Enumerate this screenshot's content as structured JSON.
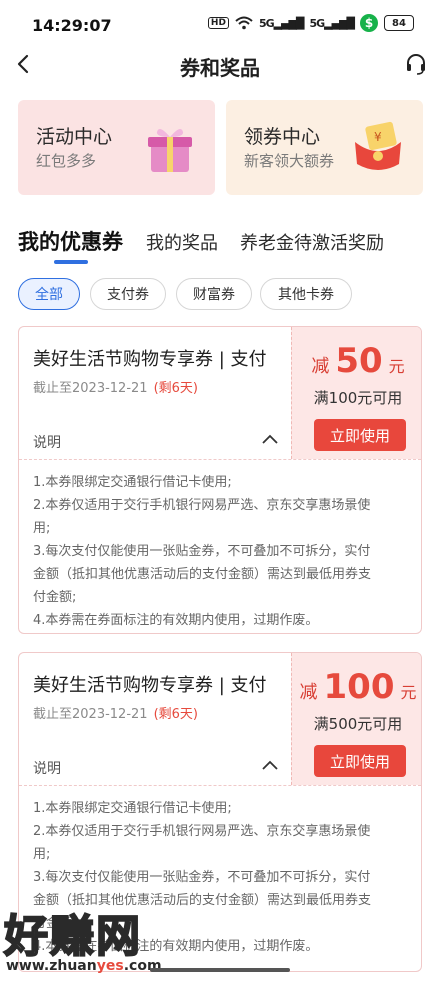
{
  "status_bar": {
    "time": "14:29:07",
    "hd_badge": "HD",
    "signal_1": "5G",
    "signal_2": "5G",
    "battery": "84",
    "icons": [
      "wifi-icon",
      "signal-icon",
      "signal-icon",
      "wallet-dollar-icon",
      "battery-icon"
    ]
  },
  "nav": {
    "title": "券和奖品",
    "back_icon": "back-arrow-icon",
    "service_icon": "headset-icon"
  },
  "feature_cards": [
    {
      "title": "活动中心",
      "subtitle": "红包多多",
      "icon": "gift-box-icon"
    },
    {
      "title": "领券中心",
      "subtitle": "新客领大额券",
      "icon": "red-envelope-icon"
    }
  ],
  "tabs": [
    {
      "label": "我的优惠券",
      "active": true
    },
    {
      "label": "我的奖品",
      "active": false
    },
    {
      "label": "养老金待激活奖励",
      "active": false
    }
  ],
  "filters": [
    {
      "label": "全部",
      "active": true
    },
    {
      "label": "支付券",
      "active": false
    },
    {
      "label": "财富券",
      "active": false
    },
    {
      "label": "其他卡券",
      "active": false
    }
  ],
  "coupons": [
    {
      "title": "美好生活节购物专享券 | 支付",
      "expire": "截止至2023-12-21",
      "remain": "(剩6天)",
      "desc_label": "说明",
      "minus": "减",
      "amount": "50",
      "unit": "元",
      "condition": "满100元可用",
      "use_label": "立即使用",
      "rules": [
        "1.本券限绑定交通银行借记卡使用;",
        "2.本券仅适用于交行手机银行网易严选、京东交享惠场景使",
        "用;",
        "3.每次支付仅能使用一张贴金券，不可叠加不可拆分，实付",
        "金额（抵扣其他优惠活动后的支付金额）需达到最低用券支",
        "付金额;",
        "4.本券需在券面标注的有效期内使用，过期作废。"
      ]
    },
    {
      "title": "美好生活节购物专享券 | 支付",
      "expire": "截止至2023-12-21",
      "remain": "(剩6天)",
      "desc_label": "说明",
      "minus": "减",
      "amount": "100",
      "unit": "元",
      "condition": "满500元可用",
      "use_label": "立即使用",
      "rules": [
        "1.本券限绑定交通银行借记卡使用;",
        "2.本券仅适用于交行手机银行网易严选、京东交享惠场景使",
        "用;",
        "3.每次支付仅能使用一张贴金券，不可叠加不可拆分，实付",
        "金额（抵扣其他优惠活动后的支付金额）需达到最低用券支",
        "付金额;",
        "4.本券需在券面标注的有效期内使用，过期作废。"
      ]
    }
  ],
  "watermark": {
    "big": "好赚网",
    "url_pre": "www.zhuan",
    "url_yes": "yes",
    "url_post": ".com"
  },
  "colors": {
    "accent_blue": "#2f6fe0",
    "coupon_red": "#e64a3d",
    "activity_bg": "#fbe3e3",
    "voucher_bg": "#fcefe2"
  }
}
